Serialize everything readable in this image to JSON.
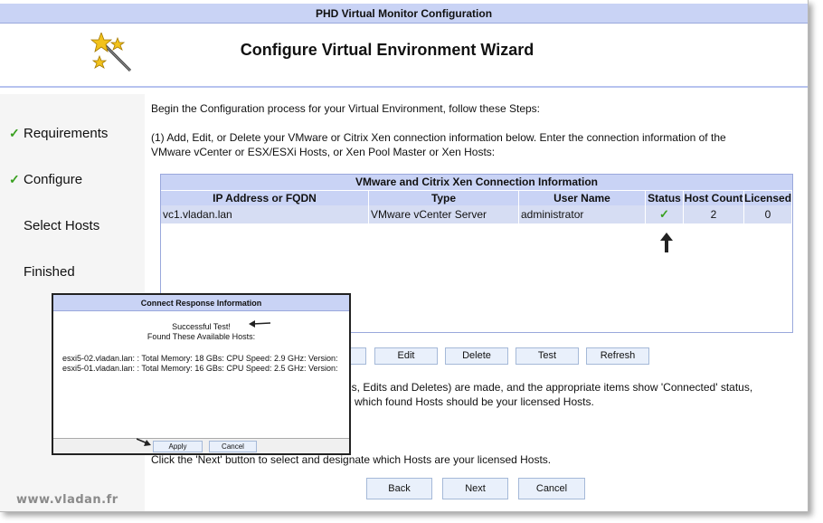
{
  "window": {
    "title": "PHD Virtual Monitor Configuration"
  },
  "header": {
    "title": "Configure Virtual Environment Wizard",
    "icon": "magic-wand-icon"
  },
  "sidebar": {
    "steps": [
      {
        "label": "Requirements",
        "done": true
      },
      {
        "label": "Configure",
        "done": true
      },
      {
        "label": "Select Hosts",
        "done": false
      },
      {
        "label": "Finished",
        "done": false
      }
    ]
  },
  "content": {
    "intro": "Begin the Configuration process for your Virtual Environment, follow these Steps:",
    "step1_line1": "(1) Add, Edit, or Delete your VMware or Citrix Xen connection information below. Enter the connection information of the",
    "step1_line2": "VMware vCenter or ESX/ESXi Hosts, or Xen Pool Master or Xen Hosts:",
    "step2_line1": "ds, Edits and Deletes) are made, and the appropriate items show 'Connected' status,",
    "step2_line2": "e which found Hosts should be your licensed Hosts.",
    "step3": "Click the 'Next' button to select and designate which Hosts are your licensed Hosts."
  },
  "table": {
    "caption": "VMware and Citrix Xen Connection Information",
    "columns": [
      "IP Address or FQDN",
      "Type",
      "User Name",
      "Status",
      "Host Count",
      "Licensed"
    ],
    "rows": [
      {
        "ip": "vc1.vladan.lan",
        "type": "VMware vCenter Server",
        "user": "administrator",
        "status": "ok",
        "host_count": "2",
        "licensed": "0"
      }
    ]
  },
  "table_buttons": {
    "edit": "Edit",
    "delete": "Delete",
    "test": "Test",
    "refresh": "Refresh"
  },
  "nav_buttons": {
    "back": "Back",
    "next": "Next",
    "cancel": "Cancel"
  },
  "dialog": {
    "title": "Connect Response Information",
    "success": "Successful Test!",
    "found": "Found These Available Hosts:",
    "hosts": [
      "esxi5-02.vladan.lan: : Total Memory: 18 GBs: CPU Speed: 2.9 GHz: Version:",
      "esxi5-01.vladan.lan: : Total Memory: 16 GBs: CPU Speed: 2.5 GHz: Version:"
    ],
    "apply": "Apply",
    "cancel": "Cancel"
  },
  "watermark": "www.vladan.fr",
  "colors": {
    "header_band": "#c9d3f5",
    "row_highlight": "#d6ddf3",
    "check_green": "#39a020"
  }
}
